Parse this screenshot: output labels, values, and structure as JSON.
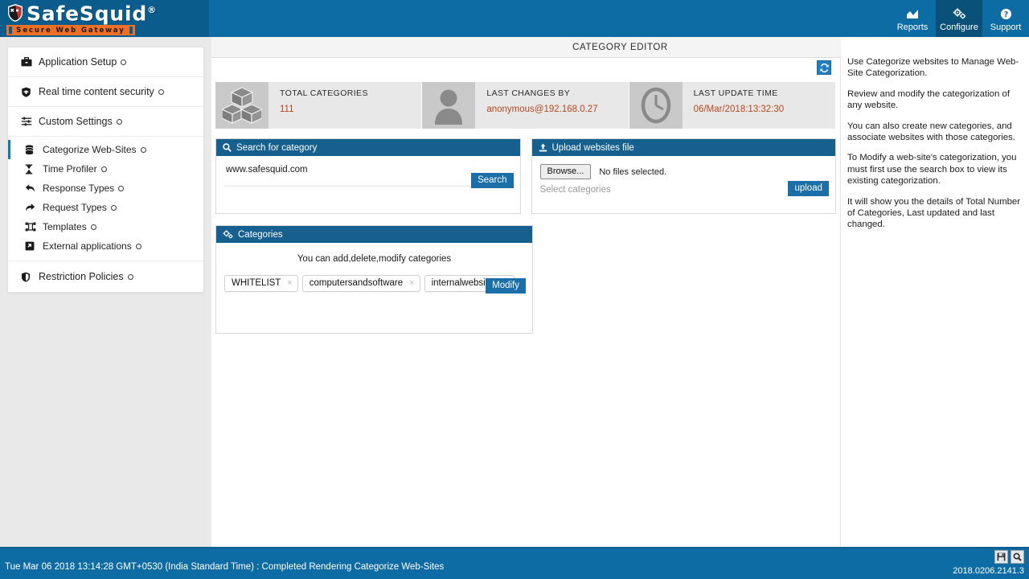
{
  "brand": {
    "name": "SafeSquid",
    "registered": "®",
    "tagline": "Secure Web Gateway",
    "shield_icon": "shield-icon"
  },
  "topnav": {
    "items": [
      {
        "label": "Reports",
        "icon": "chart-area-icon",
        "active": false
      },
      {
        "label": "Configure",
        "icon": "cogs-icon",
        "active": true
      },
      {
        "label": "Support",
        "icon": "question-circle-icon",
        "active": false
      }
    ]
  },
  "page": {
    "title": "CATEGORY EDITOR",
    "refresh_icon": "refresh-icon"
  },
  "sidebar": {
    "sections": [
      {
        "label": "Application Setup",
        "icon": "briefcase-icon"
      },
      {
        "label": "Real time content security",
        "icon": "shield-lock-icon"
      },
      {
        "label": "Custom Settings",
        "icon": "sliders-icon"
      }
    ],
    "subitems": [
      {
        "label": "Categorize Web-Sites",
        "icon": "database-icon",
        "active": true
      },
      {
        "label": "Time Profiler",
        "icon": "hourglass-icon",
        "active": false
      },
      {
        "label": "Response Types",
        "icon": "arrow-reply-icon",
        "active": false
      },
      {
        "label": "Request Types",
        "icon": "arrow-forward-icon",
        "active": false
      },
      {
        "label": "Templates",
        "icon": "template-icon",
        "active": false
      },
      {
        "label": "External applications",
        "icon": "external-app-icon",
        "active": false
      }
    ],
    "footer_item": {
      "label": "Restriction Policies",
      "icon": "shield-icon"
    }
  },
  "stats": [
    {
      "title": "TOTAL CATEGORIES",
      "value": "111",
      "icon": "cubes-icon"
    },
    {
      "title": "LAST CHANGES BY",
      "value": "anonymous@192.168.0.27",
      "icon": "user-icon"
    },
    {
      "title": "LAST UPDATE TIME",
      "value": "06/Mar/2018:13:32:30",
      "icon": "clock-icon"
    }
  ],
  "search_panel": {
    "title": "Search for category",
    "icon": "search-icon",
    "input_value": "www.safesquid.com",
    "input_placeholder": "",
    "button_label": "Search"
  },
  "upload_panel": {
    "title": "Upload websites file",
    "icon": "upload-icon",
    "browse_label": "Browse...",
    "file_status": "No files selected.",
    "select_placeholder": "Select categories",
    "button_label": "upload"
  },
  "categories_panel": {
    "title": "Categories",
    "icon": "cogs-icon",
    "help_text": "You can add,delete,modify categories",
    "chips": [
      {
        "label": "WHITELIST",
        "remove": "×"
      },
      {
        "label": "computersandsoftware",
        "remove": "×"
      },
      {
        "label": "internalwebsites",
        "remove": "×"
      }
    ],
    "button_label": "Modify"
  },
  "help": {
    "paragraphs": [
      "Use Categorize websites to Manage Web-Site Categorization.",
      "Review and modify the categorization of any website.",
      "You can also create new categories, and associate websites with those categories.",
      "To Modify a web-site's categorization, you must first use the search box to view its existing categorization.",
      "It will show you the details of Total Number of Categories, Last updated and last changed."
    ]
  },
  "statusbar": {
    "text": "Tue Mar 06 2018 13:14:28 GMT+0530 (India Standard Time) : Completed Rendering Categorize Web-Sites",
    "version": "2018.0206.2141.3",
    "icons": [
      {
        "name": "save-icon"
      },
      {
        "name": "search-icon"
      }
    ]
  },
  "colors": {
    "header_blue": "#0d6ca3",
    "header_blue_dark": "#0a5c8c",
    "panel_blue": "#15608f",
    "button_blue": "#1a6fa8",
    "accent_orange": "#ef6f24",
    "stat_value_red": "#b4471f",
    "active_border": "#1577b5"
  }
}
